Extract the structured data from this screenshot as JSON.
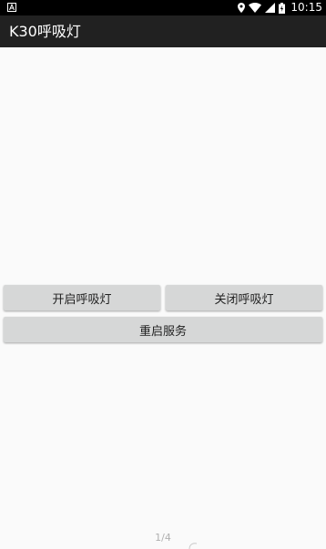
{
  "status_bar": {
    "time": "10:15",
    "icons": [
      "notification-icon",
      "location-icon",
      "wifi-icon",
      "signal-icon",
      "battery-icon"
    ]
  },
  "app_bar": {
    "title": "K30呼吸灯"
  },
  "buttons": {
    "open_label": "开启呼吸灯",
    "close_label": "关闭呼吸灯",
    "restart_label": "重启服务"
  },
  "page_indicator": "1/4",
  "colors": {
    "status_bar_bg": "#000000",
    "app_bar_bg": "#212121",
    "content_bg": "#fafafa",
    "button_bg": "#d6d7d7"
  }
}
